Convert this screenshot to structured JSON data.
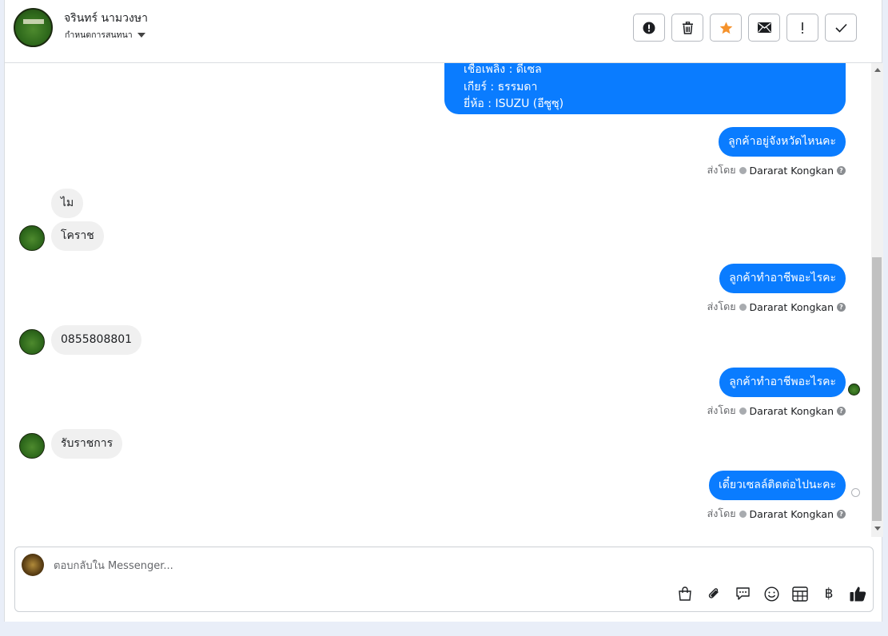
{
  "header": {
    "contact_name": "จรินทร์ นามวงษา",
    "assign_label": "กำหนดการสนทนา",
    "actions": [
      {
        "name": "alert-circle",
        "icon": "alert-circle-icon"
      },
      {
        "name": "trash",
        "icon": "trash-icon"
      },
      {
        "name": "star",
        "icon": "star-icon"
      },
      {
        "name": "mail",
        "icon": "mail-icon"
      },
      {
        "name": "exclamation",
        "icon": "exclamation-icon"
      },
      {
        "name": "check",
        "icon": "check-icon"
      }
    ]
  },
  "thread": {
    "partial_message_lines": [
      "เชื้อเพลิง : ดีเซล",
      "เกียร์ : ธรรมดา",
      "ยี่ห้อ : ISUZU (อีซูซุ)"
    ],
    "sent_by_prefix": "ส่งโดย",
    "agent_name": "Dararat Kongkan",
    "messages": [
      {
        "dir": "out",
        "text": "ลูกค้าอยู่จังหวัดไหนคะ"
      },
      {
        "dir": "in",
        "text": "ไม"
      },
      {
        "dir": "in",
        "text": "โคราช"
      },
      {
        "dir": "out",
        "text": "ลูกค้าทำอาชีพอะไรคะ"
      },
      {
        "dir": "in",
        "text": "0855808801"
      },
      {
        "dir": "out",
        "text": "ลูกค้าทำอาชีพอะไรคะ"
      },
      {
        "dir": "in",
        "text": "รับราชการ"
      },
      {
        "dir": "out",
        "text": "เดี๋ยวเซลล์ติดต่อไปนะคะ"
      }
    ]
  },
  "composer": {
    "placeholder": "ตอบกลับใน Messenger...",
    "value": "",
    "tools": [
      "shopping-bag-icon",
      "paperclip-icon",
      "chat-bubble-icon",
      "emoji-icon",
      "table-icon",
      "baht-icon",
      "thumbs-up-icon"
    ],
    "baht_symbol": "฿"
  },
  "colors": {
    "accent": "#0a7cff",
    "star": "#f5922b",
    "incoming_bubble": "#f0f0f0"
  }
}
